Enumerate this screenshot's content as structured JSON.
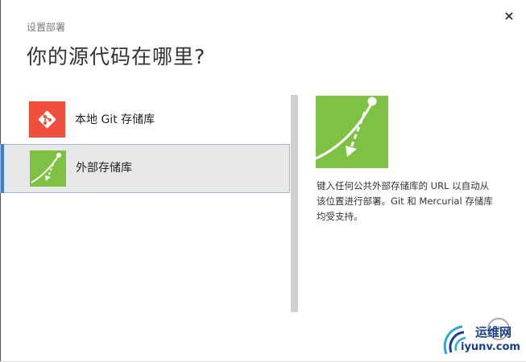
{
  "dialog": {
    "breadcrumb": "设置部署",
    "title": "你的源代码在哪里?",
    "close_glyph": "×"
  },
  "sources": [
    {
      "label": "本地 Git 存储库",
      "icon": "git-icon",
      "color": "#ef4f3c",
      "selected": false
    },
    {
      "label": "外部存储库",
      "icon": "external-repo-icon",
      "color": "#7dc242",
      "selected": true
    }
  ],
  "detail": {
    "icon": "external-repo-icon",
    "color": "#7dc242",
    "description": "键入任何公共外部存储库的 URL 以自动从该位置进行部署。Git 和 Mercurial 存储库均受支持。"
  },
  "next_glyph": "›",
  "watermark": {
    "cn": "运维网",
    "en": "iyunv.com"
  },
  "colors": {
    "selection_bg": "#e8e8e8",
    "selection_border": "#9bb9de",
    "selection_accent": "#3a7fd0",
    "git_red": "#ef4f3c",
    "external_green": "#7dc242"
  }
}
